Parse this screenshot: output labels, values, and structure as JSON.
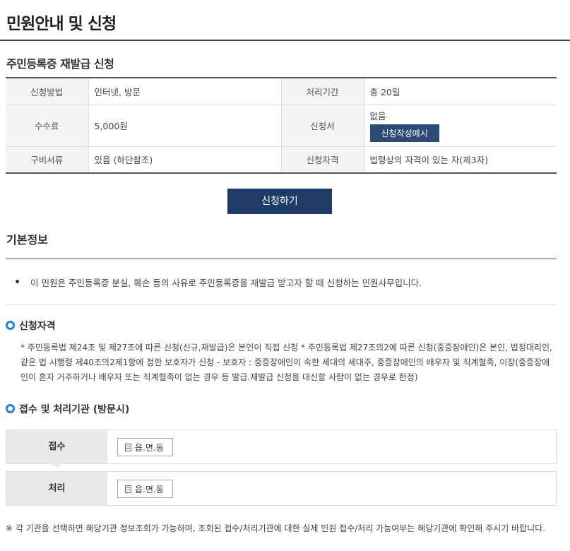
{
  "page": {
    "title": "민원안내 및 신청"
  },
  "service": {
    "title": "주민등록증 재발급 신청",
    "rows": [
      {
        "label1": "신청방법",
        "value1": "인터넷, 방문",
        "label2": "처리기간",
        "value2": "총 20일"
      },
      {
        "label1": "수수료",
        "value1": "5,000원",
        "label2": "신청서",
        "value2": "없음",
        "value2_button": "신청작성예시"
      },
      {
        "label1": "구비서류",
        "value1": "있음 (하단참조)",
        "label2": "신청자격",
        "value2": "법령상의 자격이 있는 자(제3자)"
      }
    ],
    "apply_button": "신청하기"
  },
  "basic": {
    "title": "기본정보",
    "bullet": "이 민원은 주민등록증 분실, 훼손 등의 사유로 주민등록증을 재발급 받고자 할 때 신청하는 민원사무입니다."
  },
  "qualification": {
    "title": "신청자격",
    "text": "* 주민등록법 제24조 및 제27조에 따른 신청(신규,재발급)은 본인이 직접 신청 * 주민등록법 제27조의2에 따른 신청(중증장애인)은 본인, 법정대리인, 같은 법 시행령 제40조의2제1항에 정한 보호자가 신청 - 보호자 : 중증장애인이 속한 세대의 세대주, 중증장애인의 배우자 및 직계혈족, 이장(중증장애인이 혼자 거주하거나 배우자 또는 직계혈족이 없는 경우 등 발급.재발급 신청을 대신할 사람이 없는 경우로 한정)"
  },
  "agency": {
    "title": "접수 및 처리기관 (방문시)",
    "receive_label": "접수",
    "receive_button": "읍.면.동",
    "process_label": "처리",
    "process_button": "읍.면.동",
    "note": "※ 각 기관을 선택하면 해당기관 정보조회가 가능하며, 조회된 접수/처리기관에 대한 실제 민원 접수/처리 가능여부는 해당기관에 확인해 주시기 바랍니다."
  },
  "icons": {
    "section": "circle-icon",
    "building": "building-icon",
    "bullet": "bullet-dot"
  },
  "colors": {
    "accent": "#2b7fd0",
    "button": "#1e3c66",
    "example_button": "#2c4a76"
  }
}
